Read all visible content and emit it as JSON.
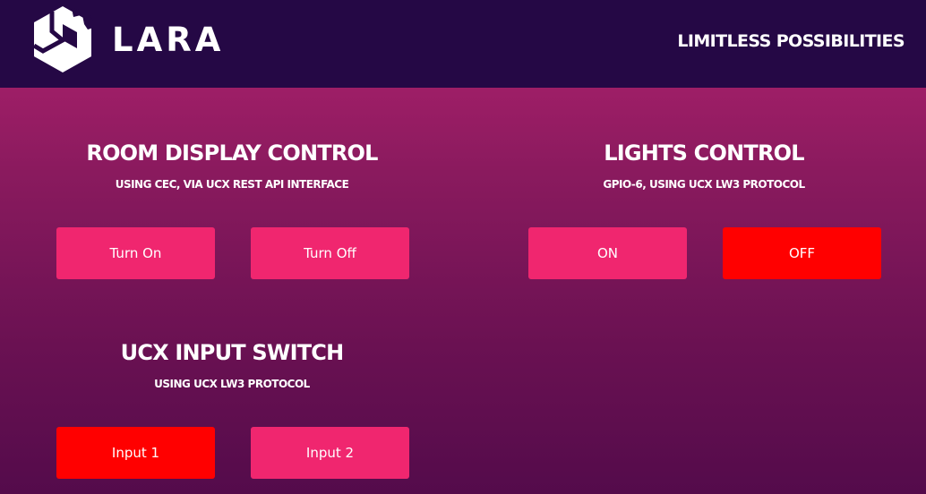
{
  "header": {
    "logo_icon": "lara-cube-logo-icon",
    "brand": "LARA",
    "tagline": "LIMITLESS POSSIBILITIES"
  },
  "colors": {
    "header_bg": "#250845",
    "button": "#f0266f",
    "button_active": "#ff0000",
    "bg_top": "#b2226f",
    "bg_bottom": "#540b4b"
  },
  "room_display": {
    "title": "ROOM DISPLAY CONTROL",
    "subtitle": "USING CEC, VIA UCX REST API INTERFACE",
    "on_label": "Turn On",
    "off_label": "Turn Off"
  },
  "lights": {
    "title": "LIGHTS CONTROL",
    "subtitle": "GPIO-6, USING UCX LW3 PROTOCOL",
    "on_label": "ON",
    "off_label": "OFF",
    "active": "OFF"
  },
  "input_switch": {
    "title": "UCX INPUT SWITCH",
    "subtitle": "USING UCX LW3 PROTOCOL",
    "input1_label": "Input 1",
    "input2_label": "Input 2",
    "active": "Input 1"
  }
}
